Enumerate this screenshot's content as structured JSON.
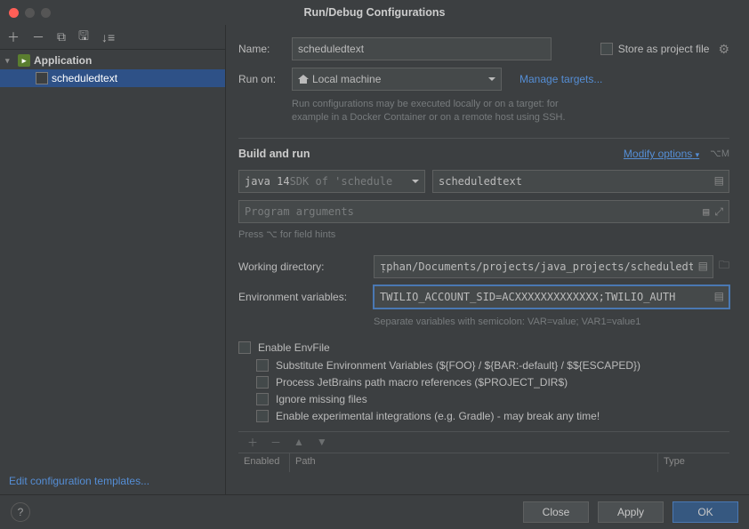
{
  "window": {
    "title": "Run/Debug Configurations"
  },
  "sidebar": {
    "parent_label": "Application",
    "child_label": "scheduledtext",
    "footer_link": "Edit configuration templates..."
  },
  "form": {
    "name_label": "Name:",
    "name_value": "scheduledtext",
    "store_label": "Store as project file",
    "run_on_label": "Run on:",
    "run_on_value": "Local machine",
    "manage_targets": "Manage targets...",
    "run_on_hint": "Run configurations may be executed locally or on a target: for example in a Docker Container or on a remote host using SSH.",
    "build_section": "Build and run",
    "modify_options": "Modify options",
    "modify_shortcut": "⌥M",
    "sdk_prefix": "java 14",
    "sdk_suffix": " SDK of 'schedule",
    "module_value": "scheduledtext",
    "program_args_placeholder": "Program arguments",
    "field_hints": "Press ⌥ for field hints",
    "wd_label": "Working directory:",
    "wd_value": "ᴉphan/Documents/projects/java_projects/scheduledtext",
    "env_label": "Environment variables:",
    "env_value": "TWILIO_ACCOUNT_SID=ACXXXXXXXXXXXXX;TWILIO_AUTH",
    "env_hint": "Separate variables with semicolon: VAR=value; VAR1=value1",
    "enable_envfile": "Enable EnvFile",
    "sub1": "Substitute Environment Variables (${FOO} / ${BAR:-default} / $${ESCAPED})",
    "sub2": "Process JetBrains path macro references ($PROJECT_DIR$)",
    "sub3": "Ignore missing files",
    "sub4": "Enable experimental integrations (e.g. Gradle) - may break any time!"
  },
  "table": {
    "col_enabled": "Enabled",
    "col_path": "Path",
    "col_type": "Type"
  },
  "buttons": {
    "close": "Close",
    "apply": "Apply",
    "ok": "OK"
  }
}
